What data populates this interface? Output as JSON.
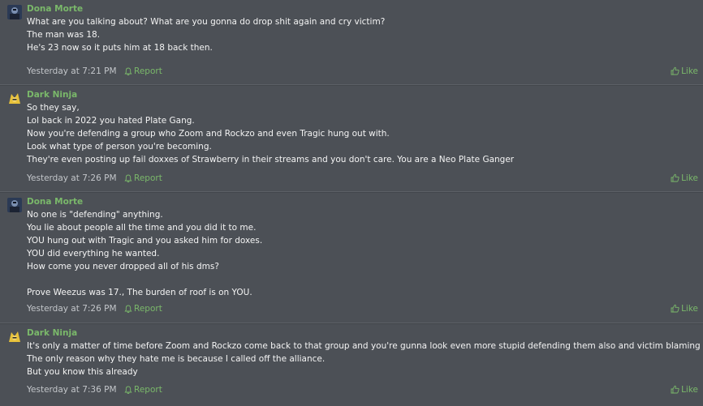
{
  "posts": [
    {
      "author": "Dona Morte",
      "avatar_icon": "dona-morte-avatar-icon",
      "lines": [
        "What are you talking about? What are you gonna do drop shit again and cry victim?",
        "The man was 18.",
        "He's 23 now so it puts him at 18 back then."
      ],
      "time": "Yesterday at 7:21 PM",
      "report_label": "Report",
      "like_label": "Like"
    },
    {
      "author": "Dark Ninja",
      "avatar_icon": "dark-ninja-avatar-icon",
      "lines": [
        "So they say,",
        "Lol back in 2022 you hated Plate Gang.",
        "Now you're defending a group who Zoom and Rockzo and even Tragic hung out with.",
        "Look what type of person you're becoming.",
        "They're even posting up fail doxxes of Strawberry in their streams and you don't care. You are a Neo Plate Ganger"
      ],
      "time": "Yesterday at 7:26 PM",
      "report_label": "Report",
      "like_label": "Like"
    },
    {
      "author": "Dona Morte",
      "avatar_icon": "dona-morte-avatar-icon",
      "lines": [
        "No one is \"defending\" anything.",
        "You lie about people all the time and you did it to me.",
        "YOU hung out with Tragic and you asked him for doxes.",
        "YOU did everything he wanted.",
        "How come you never dropped all of his dms?",
        "",
        "Prove Weezus was 17., The burden of roof is on YOU."
      ],
      "time": "Yesterday at 7:26 PM",
      "report_label": "Report",
      "like_label": "Like"
    },
    {
      "author": "Dark Ninja",
      "avatar_icon": "dark-ninja-avatar-icon",
      "lines": [
        "It's only a matter of time before Zoom and Rockzo come back to that group and you're gunna look even more stupid defending them also and victim blaming again.",
        "The only reason why they hate me is because I called off the alliance.",
        "But you know this already"
      ],
      "time": "Yesterday at 7:36 PM",
      "report_label": "Report",
      "like_label": "Like"
    }
  ],
  "colors": {
    "background": "#4c5056",
    "accent": "#7ab86a",
    "text": "#f4f4f4",
    "muted": "#c3c6ca"
  }
}
